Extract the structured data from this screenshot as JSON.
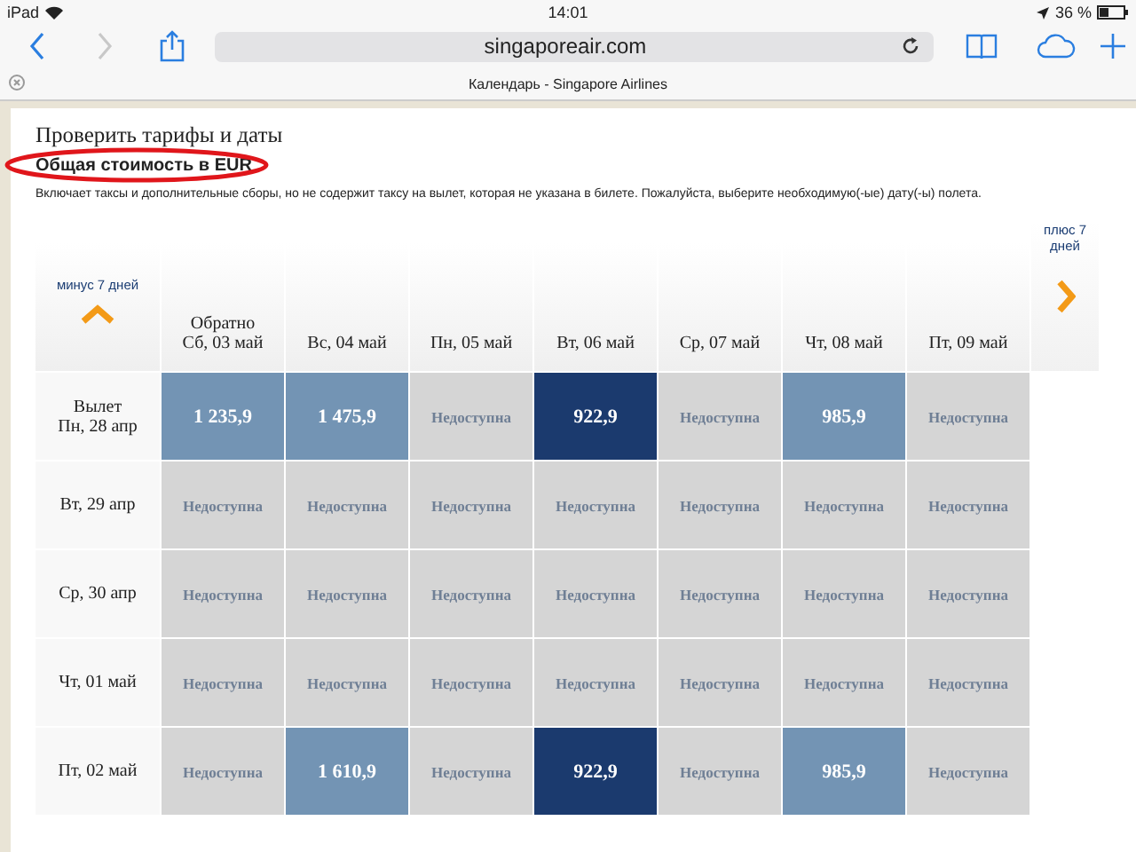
{
  "status_bar": {
    "device": "iPad",
    "time": "14:01",
    "battery": "36 %"
  },
  "browser": {
    "url": "singaporeair.com",
    "tab_title": "Календарь - Singapore Airlines"
  },
  "page": {
    "heading": "Проверить тарифы и даты",
    "subheading": "Общая стоимость в EUR",
    "note": "Включает таксы и дополнительные сборы, но не содержит таксу на вылет, которая не указана в билете. Пожалуйста, выберите необходимую(-ые) дату(-ы) полета.",
    "prev_week": "минус 7 дней",
    "next_week": "плюс 7 дней",
    "return_label": "Обратно",
    "depart_label": "Вылет",
    "columns": [
      "Сб, 03 май",
      "Вс, 04 май",
      "Пн, 05 май",
      "Вт, 06 май",
      "Ср, 07 май",
      "Чт, 08 май",
      "Пт, 09 май"
    ],
    "rows": [
      {
        "date": "Пн, 28 апр",
        "cells": [
          {
            "kind": "price",
            "text": "1 235,9"
          },
          {
            "kind": "price",
            "text": "1 475,9"
          },
          {
            "kind": "unavailable",
            "text": "Недоступна"
          },
          {
            "kind": "cheapest",
            "text": "922,9"
          },
          {
            "kind": "unavailable",
            "text": "Недоступна"
          },
          {
            "kind": "price",
            "text": "985,9"
          },
          {
            "kind": "unavailable",
            "text": "Недоступна"
          }
        ]
      },
      {
        "date": "Вт, 29 апр",
        "cells": [
          {
            "kind": "unavailable",
            "text": "Недоступна"
          },
          {
            "kind": "unavailable",
            "text": "Недоступна"
          },
          {
            "kind": "unavailable",
            "text": "Недоступна"
          },
          {
            "kind": "unavailable",
            "text": "Недоступна"
          },
          {
            "kind": "unavailable",
            "text": "Недоступна"
          },
          {
            "kind": "unavailable",
            "text": "Недоступна"
          },
          {
            "kind": "unavailable",
            "text": "Недоступна"
          }
        ]
      },
      {
        "date": "Ср, 30 апр",
        "cells": [
          {
            "kind": "unavailable",
            "text": "Недоступна"
          },
          {
            "kind": "unavailable",
            "text": "Недоступна"
          },
          {
            "kind": "unavailable",
            "text": "Недоступна"
          },
          {
            "kind": "unavailable",
            "text": "Недоступна"
          },
          {
            "kind": "unavailable",
            "text": "Недоступна"
          },
          {
            "kind": "unavailable",
            "text": "Недоступна"
          },
          {
            "kind": "unavailable",
            "text": "Недоступна"
          }
        ]
      },
      {
        "date": "Чт, 01 май",
        "cells": [
          {
            "kind": "unavailable",
            "text": "Недоступна"
          },
          {
            "kind": "unavailable",
            "text": "Недоступна"
          },
          {
            "kind": "unavailable",
            "text": "Недоступна"
          },
          {
            "kind": "unavailable",
            "text": "Недоступна"
          },
          {
            "kind": "unavailable",
            "text": "Недоступна"
          },
          {
            "kind": "unavailable",
            "text": "Недоступна"
          },
          {
            "kind": "unavailable",
            "text": "Недоступна"
          }
        ]
      },
      {
        "date": "Пт, 02 май",
        "cells": [
          {
            "kind": "unavailable",
            "text": "Недоступна"
          },
          {
            "kind": "price",
            "text": "1 610,9"
          },
          {
            "kind": "unavailable",
            "text": "Недоступна"
          },
          {
            "kind": "cheapest",
            "text": "922,9"
          },
          {
            "kind": "unavailable",
            "text": "Недоступна"
          },
          {
            "kind": "price",
            "text": "985,9"
          },
          {
            "kind": "unavailable",
            "text": "Недоступна"
          }
        ]
      }
    ]
  }
}
